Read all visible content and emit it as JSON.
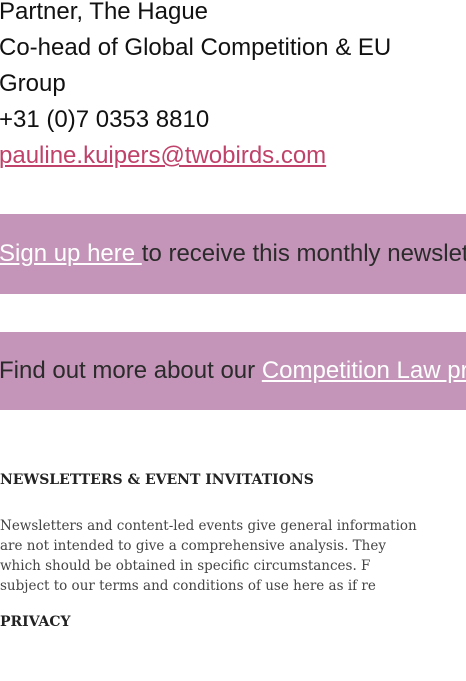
{
  "contact": {
    "title_line": "Partner, The Hague",
    "role_line_1": "Co-head of Global Competition & EU",
    "role_line_2": "Group",
    "phone": "+31 (0)7 0353 8810",
    "email": "pauline.kuipers@twobirds.com"
  },
  "signup_banner": {
    "link_text": "Sign up here ",
    "text": "to receive this monthly newsletter"
  },
  "findout_banner": {
    "text": "Find out more about our ",
    "link_text": "Competition Law practice"
  },
  "newsletters": {
    "heading": "NEWSLETTERS & EVENT INVITATIONS",
    "body_lines": [
      "Newsletters and content-led events give general information",
      "are not intended to give a comprehensive analysis. They",
      "which should be obtained in specific circumstances. F",
      "subject to our terms and conditions of use here as if re"
    ]
  },
  "privacy": {
    "heading": "PRIVACY"
  },
  "colors": {
    "banner_bg": "#c495b8",
    "link_accent": "#c0426a",
    "banner_link": "#ffffff"
  }
}
